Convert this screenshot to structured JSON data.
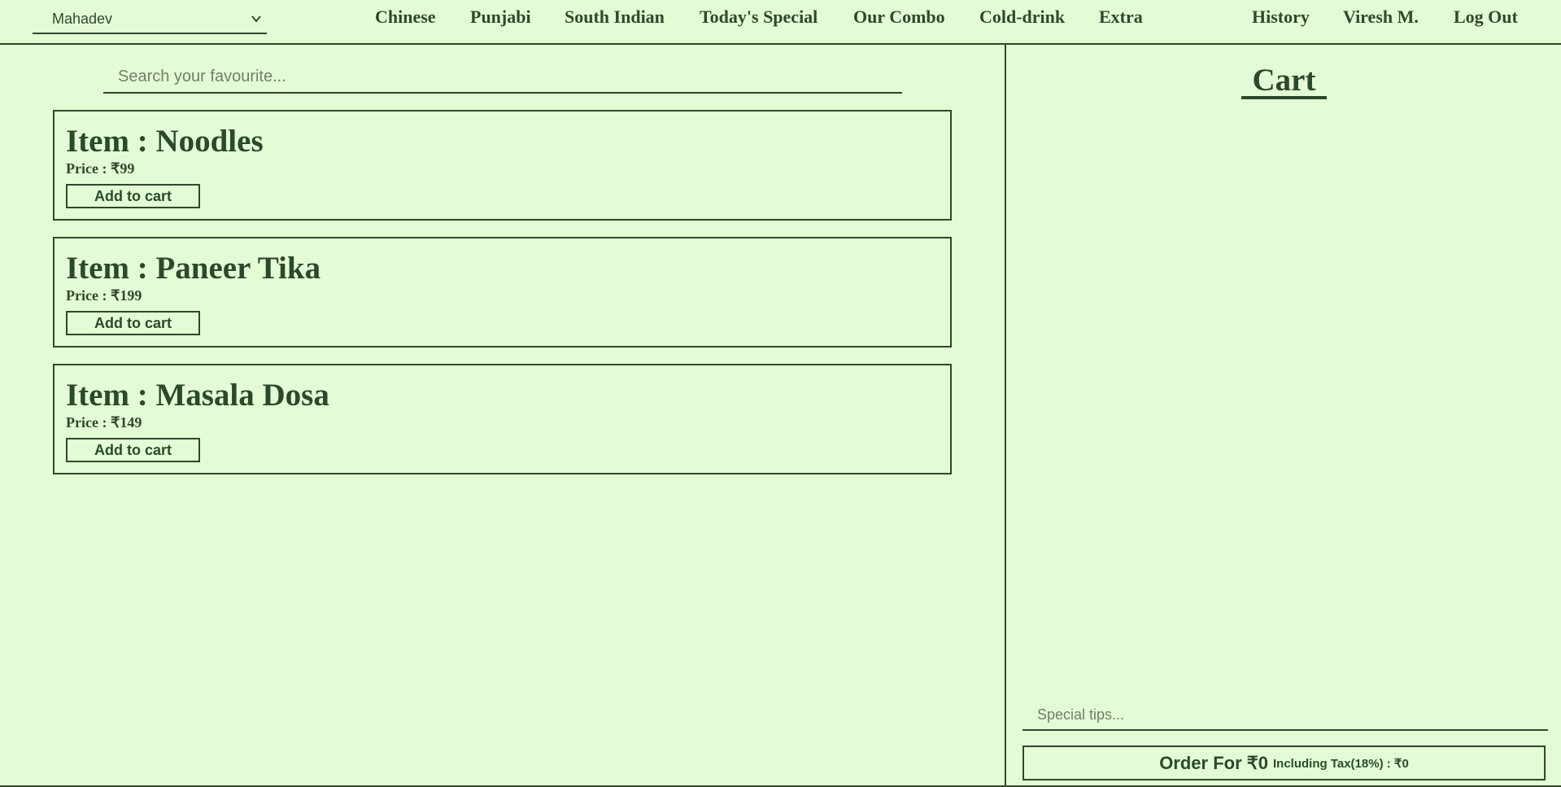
{
  "header": {
    "store_select": {
      "value": "Mahadev"
    },
    "categories": [
      {
        "label": "Chinese"
      },
      {
        "label": "Punjabi"
      },
      {
        "label": "South Indian"
      },
      {
        "label": "Today's Special"
      },
      {
        "label": "Our Combo"
      },
      {
        "label": "Cold-drink"
      },
      {
        "label": "Extra"
      }
    ],
    "right_links": [
      {
        "label": "History"
      },
      {
        "label": "Viresh M."
      },
      {
        "label": "Log Out"
      }
    ]
  },
  "search": {
    "placeholder": "Search your favourite..."
  },
  "items": [
    {
      "title": "Item : Noodles",
      "price": "Price : ₹99",
      "button": "Add to cart"
    },
    {
      "title": "Item : Paneer Tika",
      "price": "Price : ₹199",
      "button": "Add to cart"
    },
    {
      "title": "Item : Masala Dosa",
      "price": "Price : ₹149",
      "button": "Add to cart"
    }
  ],
  "cart": {
    "title": "Cart",
    "tips_placeholder": "Special tips...",
    "order_label": "Order For ₹0",
    "tax_label": "Including Tax(18%) : ₹0"
  },
  "colors": {
    "background": "#e4fcd6",
    "foreground": "#2b4a2b"
  },
  "icons": {
    "store_select": "chevron-down-icon"
  }
}
